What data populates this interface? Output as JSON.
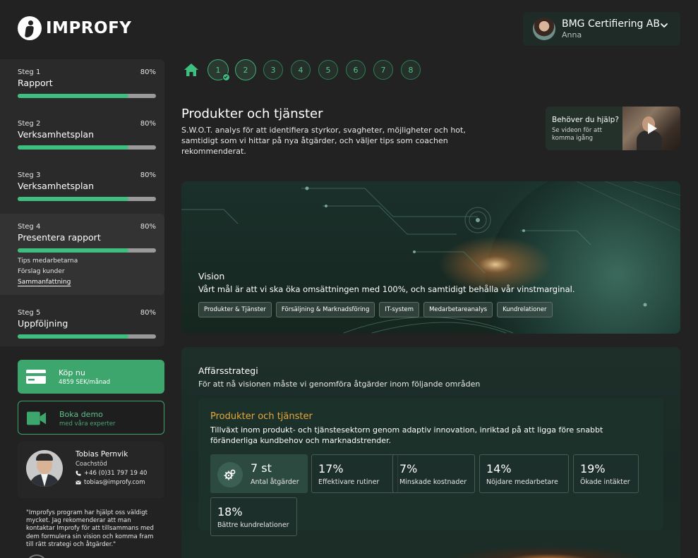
{
  "brand": {
    "name": "IMPROFY"
  },
  "account": {
    "company": "BMG Certifiering AB",
    "user": "Anna"
  },
  "colors": {
    "accent": "#3fbf7f",
    "highlight": "#e4a93c",
    "background": "#222222"
  },
  "steps": [
    {
      "number": "Steg 1",
      "title": "Rapport",
      "percent": "80%",
      "progress": 0.8
    },
    {
      "number": "Steg 2",
      "title": "Verksamhetsplan",
      "percent": "80%",
      "progress": 0.8
    },
    {
      "number": "Steg 3",
      "title": "Verksamhetsplan",
      "percent": "80%",
      "progress": 0.8
    },
    {
      "number": "Steg 4",
      "title": "Presentera rapport",
      "percent": "80%",
      "progress": 0.8,
      "subitems": [
        "Tips medarbetarna",
        "Förslag kunder",
        "Sammanfattning"
      ]
    },
    {
      "number": "Steg 5",
      "title": "Uppföljning",
      "percent": "80%",
      "progress": 0.8
    }
  ],
  "cta": {
    "buy": {
      "label": "Köp nu",
      "sub": "4859 SEK/månad",
      "icon": "credit-card-icon"
    },
    "demo": {
      "label": "Boka demo",
      "sub": "med våra experter",
      "icon": "video-camera-icon"
    }
  },
  "coach": {
    "name": "Tobias Pernvik",
    "role": "Coachstöd",
    "phone": "+46 (0)31 797 19 40",
    "email": "tobias@improfy.com"
  },
  "testimonial": "\"Improfys program har hjälpt oss väldigt mycket. Jag rekomenderar att man kontaktar Improfy för att tillsammans med dem formulera sin vision och komma fram till rätt strategi och åtgärder.\"",
  "nav": {
    "steps": [
      "1",
      "2",
      "3",
      "4",
      "5",
      "6",
      "7",
      "8"
    ],
    "completed": [
      "1"
    ],
    "current": "2"
  },
  "page": {
    "title": "Produkter och tjänster",
    "description": "S.W.O.T. analys för att identifiera styrkor, svagheter, möjligheter och hot, samtidigt som vi hittar på nya åtgärder, och väljer tips som coachen rekommenderat."
  },
  "help": {
    "title": "Behöver du hjälp?",
    "sub": "Se videon för att komma igång"
  },
  "vision": {
    "label": "Vision",
    "text": "Vårt mål är att vi ska öka omsättningen med 100%, och samtidigt behålla vår vinstmarginal.",
    "tags": [
      "Produkter & Tjänster",
      "Försäljning & Marknadsföring",
      "IT-system",
      "Medarbetareanalys",
      "Kundrelationer"
    ]
  },
  "strategy": {
    "title": "Affärsstrategi",
    "subtitle": "För att nå visionen måste vi genomföra åtgärder inom följande områden",
    "area": {
      "title": "Produkter och tjänster",
      "description": "Tillväxt inom produkt- och tjänstesektorn genom adaptiv innovation, inriktad på att ligga före snabbt föränderliga kundbehov och marknadstrender.",
      "metrics": [
        {
          "value": "7 st",
          "label": "Antal åtgärder",
          "icon": "gears-icon"
        },
        {
          "value": "17%",
          "label": "Effektivare rutiner"
        },
        {
          "value": "7%",
          "label": "Minskade kostnader"
        },
        {
          "value": "14%",
          "label": "Nöjdare medarbetare"
        },
        {
          "value": "19%",
          "label": "Ökade intäkter"
        },
        {
          "value": "18%",
          "label": "Bättre kundrelationer"
        }
      ]
    }
  }
}
